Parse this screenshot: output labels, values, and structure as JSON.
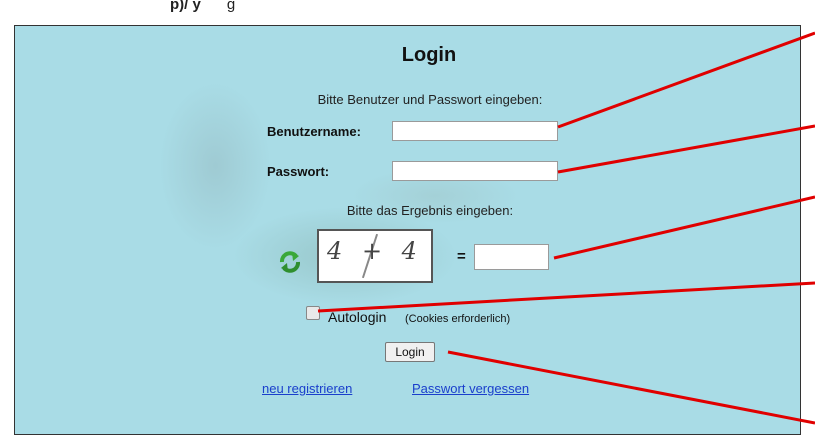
{
  "caption": {
    "bold": "p)/ y",
    "rest": "g"
  },
  "login": {
    "title": "Login",
    "instruction": "Bitte Benutzer und Passwort eingeben:",
    "username_label": "Benutzername:",
    "username_value": "",
    "password_label": "Passwort:",
    "password_value": "",
    "captcha_instruction": "Bitte das Ergebnis eingeben:",
    "captcha_text": "4 + 4",
    "equals": "=",
    "captcha_answer": "",
    "autologin_label": "Autologin",
    "autologin_checked": false,
    "cookies_note": "(Cookies erforderlich)",
    "login_button": "Login",
    "register_link": "neu registrieren",
    "forgot_link": "Passwort vergessen"
  },
  "colors": {
    "panel_bg": "#a9dce6",
    "pointer_lines": "#e00000",
    "link": "#1a3fcc",
    "refresh_icon": "#3aa83a"
  },
  "icons": [
    "refresh-icon"
  ]
}
